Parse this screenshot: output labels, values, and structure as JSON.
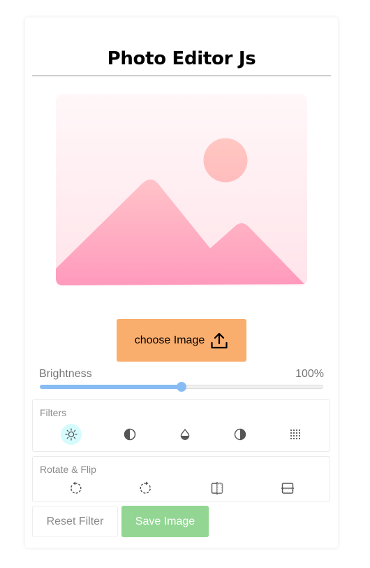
{
  "app": {
    "title": "Photo Editor Js"
  },
  "preview": {
    "icon": "image-placeholder-icon"
  },
  "upload": {
    "label": "choose Image",
    "icon": "upload-icon"
  },
  "brightness": {
    "label": "Brightness",
    "value_text": "100%",
    "slider_fraction": 0.5
  },
  "filters": {
    "title": "Filters",
    "items": [
      {
        "icon": "brightness-icon",
        "active": true
      },
      {
        "icon": "contrast-icon",
        "active": false
      },
      {
        "icon": "saturation-drop-icon",
        "active": false
      },
      {
        "icon": "invert-icon",
        "active": false
      },
      {
        "icon": "grain-dots-icon",
        "active": false
      }
    ]
  },
  "rotate_flip": {
    "title": "Rotate & Flip",
    "items": [
      {
        "icon": "rotate-left-icon"
      },
      {
        "icon": "rotate-right-icon"
      },
      {
        "icon": "flip-horizontal-icon"
      },
      {
        "icon": "flip-vertical-icon"
      }
    ]
  },
  "actions": {
    "reset_label": "Reset Filter",
    "save_label": "Save Image"
  },
  "colors": {
    "accent_orange": "#f9ae6e",
    "save_green": "#93d694",
    "slider_blue": "#86bcf3",
    "active_filter_bg": "#d6fbfd"
  }
}
